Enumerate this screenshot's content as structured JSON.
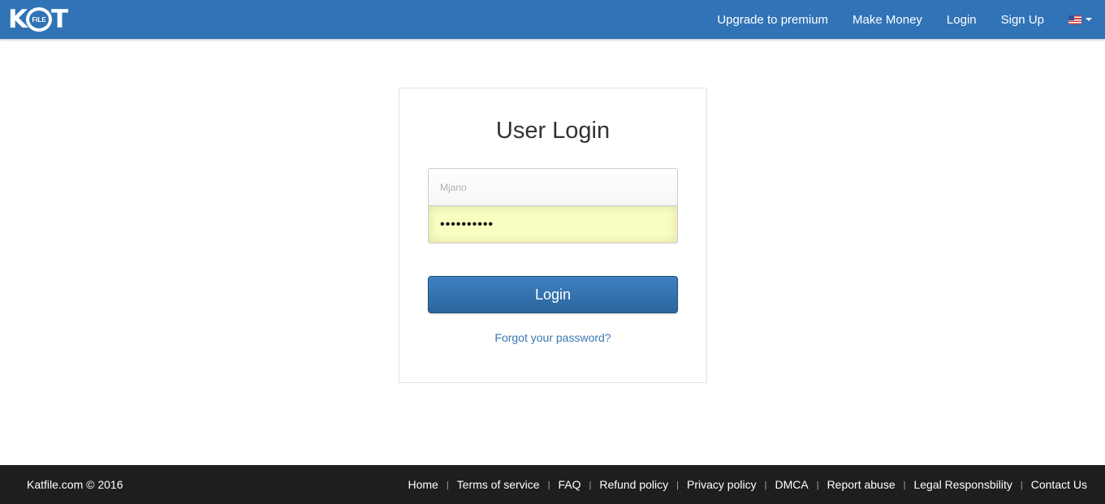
{
  "brand": {
    "logo_left": "K",
    "logo_ring": "FILE",
    "logo_right": "T",
    "color": "#3173b7"
  },
  "nav": {
    "links": [
      "Upgrade to premium",
      "Make Money",
      "Login",
      "Sign Up"
    ],
    "language_icon": "us-flag-icon"
  },
  "login": {
    "title": "User Login",
    "username_value": "Mjano",
    "password_value": "••••••••••",
    "button_label": "Login",
    "forgot_label": "Forgot your password?"
  },
  "footer": {
    "copyright": "Katfile.com © 2016",
    "links": [
      "Home",
      "Terms of service",
      "FAQ",
      "Refund policy",
      "Privacy policy",
      "DMCA",
      "Report abuse",
      "Legal Responsbility",
      "Contact Us"
    ],
    "separator": "|"
  }
}
